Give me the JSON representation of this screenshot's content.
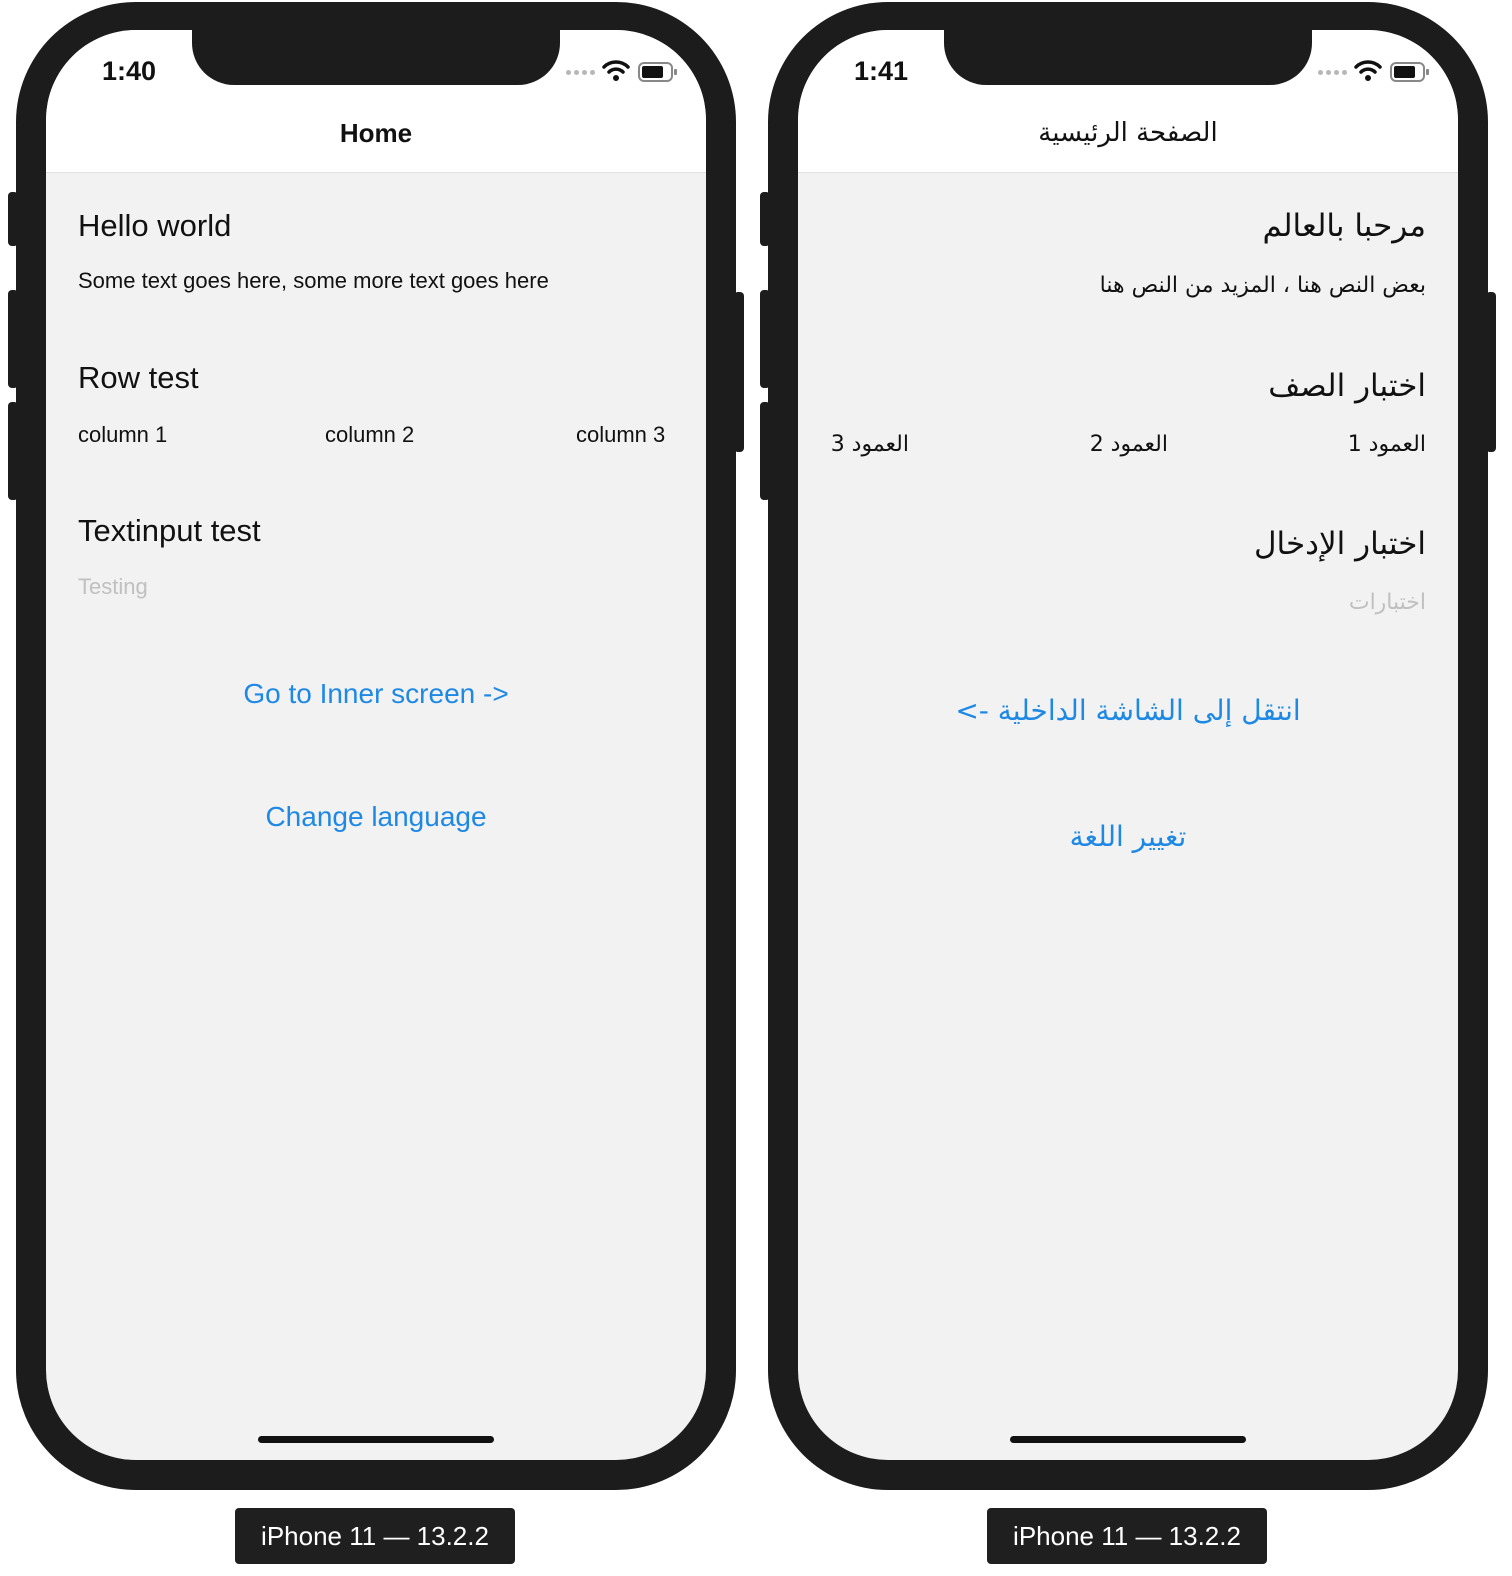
{
  "left_device": {
    "status_time": "1:40",
    "nav_title": "Home",
    "hello_heading": "Hello world",
    "body_text": "Some text goes here, some more text goes here",
    "row_heading": "Row test",
    "columns": [
      "column 1",
      "column 2",
      "column 3"
    ],
    "input_heading": "Textinput test",
    "input_placeholder": "Testing",
    "inner_link": "Go to Inner screen ->",
    "language_link": "Change language",
    "caption": "iPhone 11 — 13.2.2"
  },
  "right_device": {
    "status_time": "1:41",
    "nav_title": "الصفحة الرئيسية",
    "hello_heading": "مرحبا بالعالم",
    "body_text": "بعض النص هنا ، المزيد من النص هنا",
    "row_heading": "اختبار الصف",
    "columns": [
      "العمود 1",
      "العمود 2",
      "العمود 3"
    ],
    "input_heading": "اختبار الإدخال",
    "input_placeholder": "اختبارات",
    "inner_link": "انتقل إلى الشاشة الداخلية ->",
    "language_link": "تغيير اللغة",
    "caption": "iPhone 11 — 13.2.2"
  },
  "colors": {
    "link": "#1e88e5",
    "screen_background": "#f2f2f2",
    "navbar_background": "#ffffff",
    "frame": "#1c1c1c",
    "placeholder": "#c0c0c0"
  },
  "icons": [
    "cellular-signal-icon",
    "wifi-icon",
    "battery-icon"
  ]
}
